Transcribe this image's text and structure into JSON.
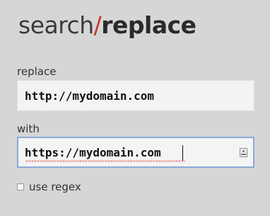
{
  "logo": {
    "word1": "search",
    "slash": "/",
    "word2": "replace"
  },
  "replace": {
    "label": "replace",
    "value": "http://mydomain.com"
  },
  "with": {
    "label": "with",
    "value": "https://mydomain.com"
  },
  "regex": {
    "label": "use regex",
    "checked": false
  },
  "colors": {
    "background": "#d6d6d6",
    "accent_slash": "#c8352a",
    "focus_border": "#8aa9d8"
  },
  "icons": {
    "autofill": "contact-card-icon",
    "regex_checkbox": "checkbox-unchecked"
  }
}
